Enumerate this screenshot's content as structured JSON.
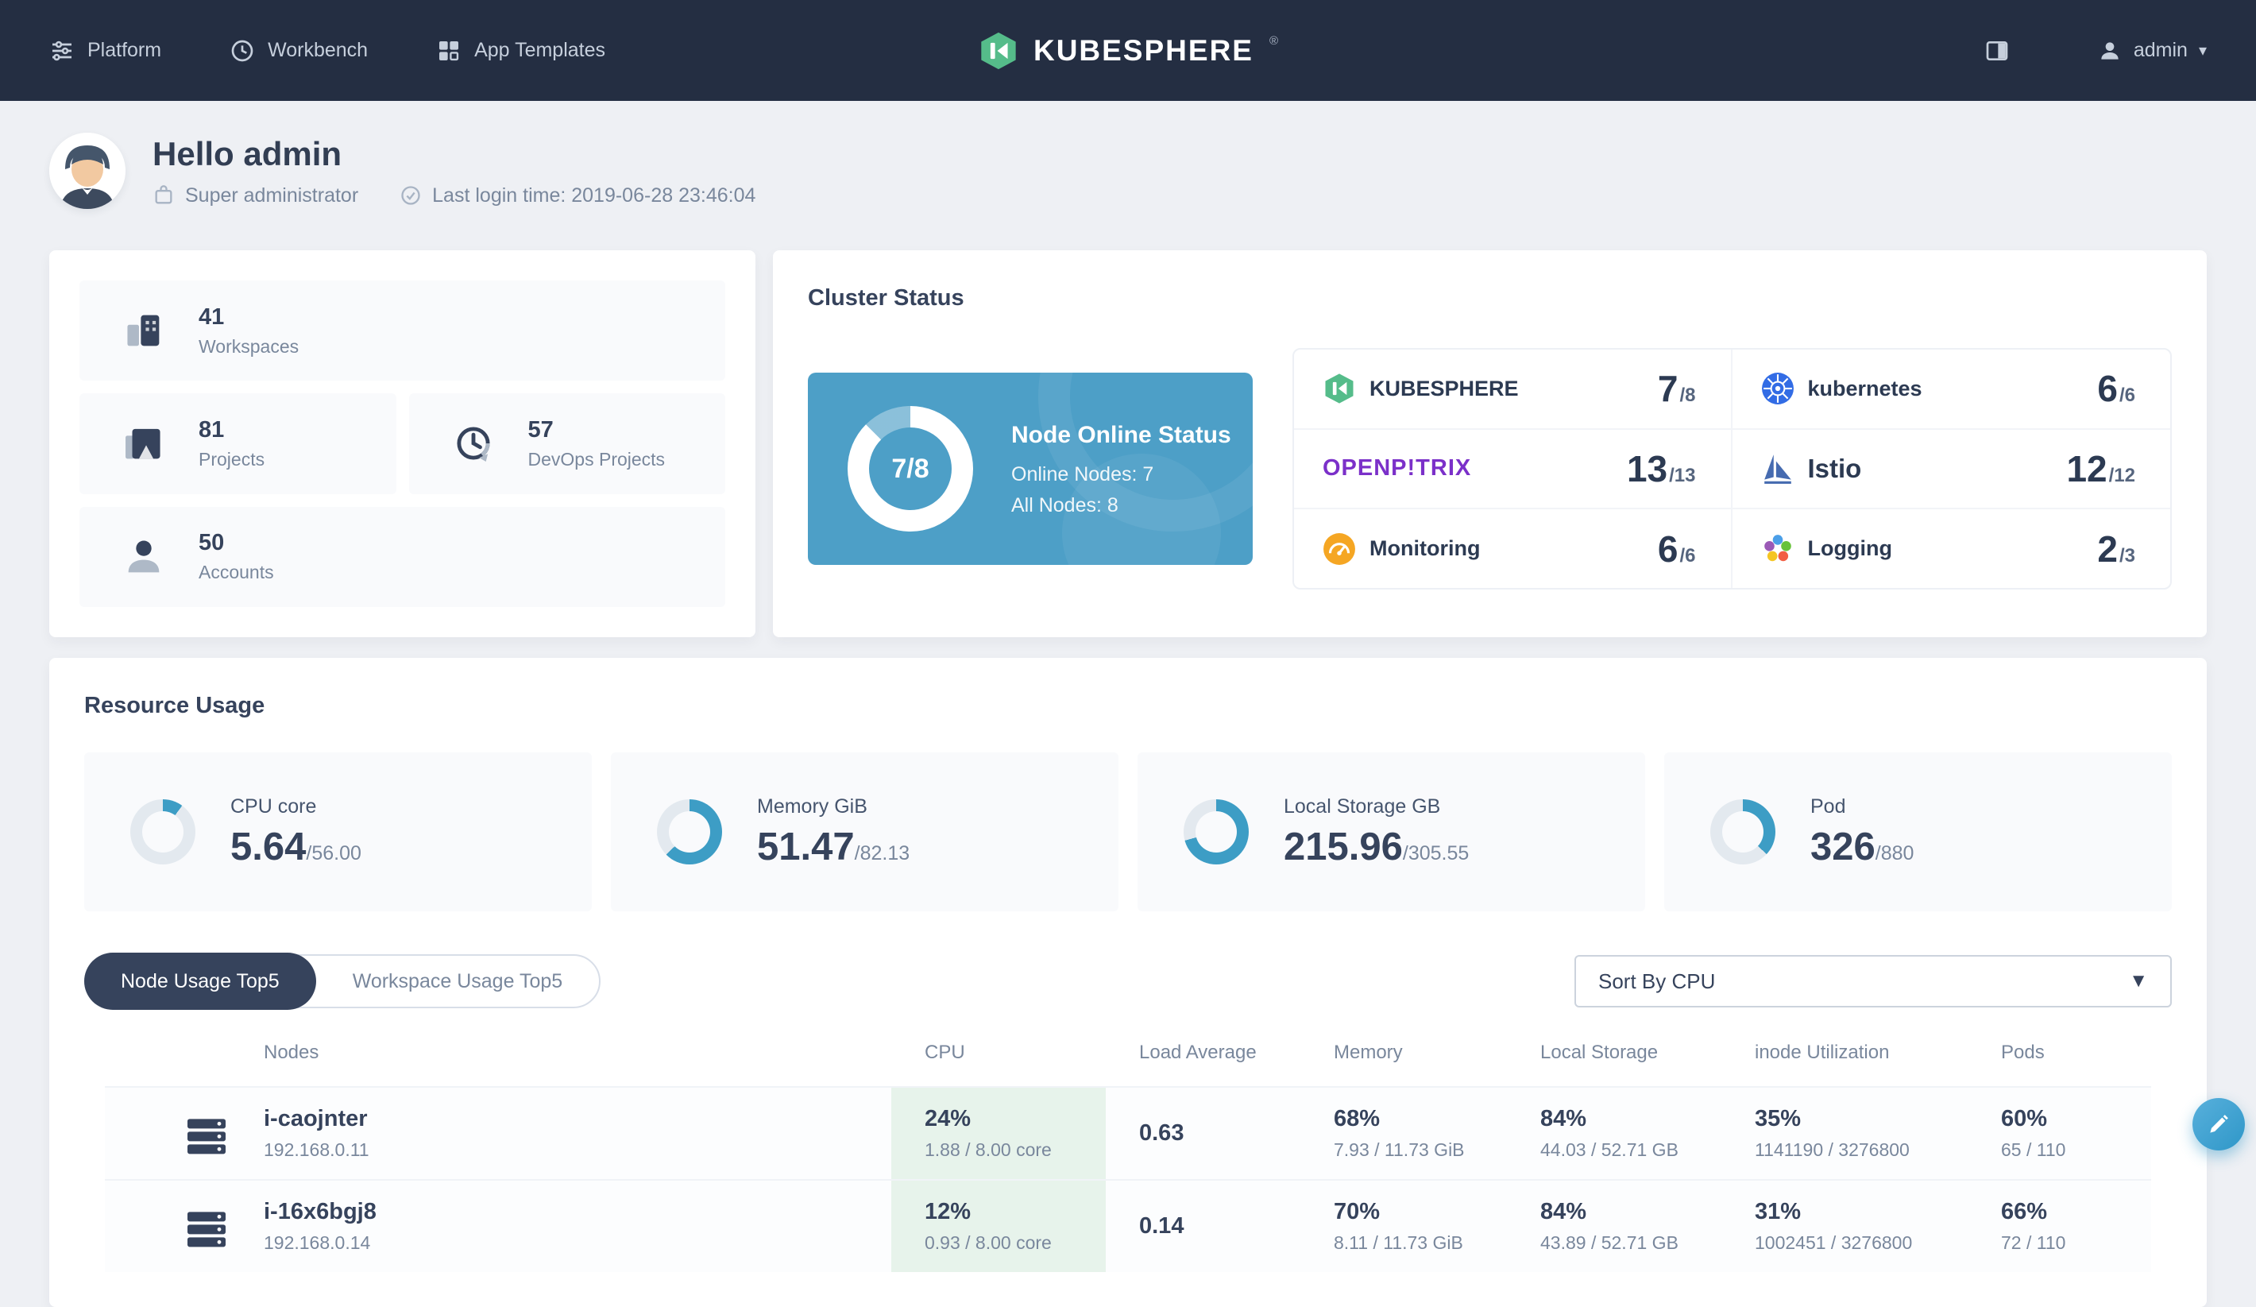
{
  "navbar": {
    "items": [
      {
        "label": "Platform"
      },
      {
        "label": "Workbench"
      },
      {
        "label": "App Templates"
      }
    ],
    "logo_text": "KUBESPHERE",
    "logo_reg": "®",
    "user": "admin",
    "caret": "▾"
  },
  "header": {
    "greeting": "Hello admin",
    "role": "Super administrator",
    "last_login": "Last login time: 2019-06-28 23:46:04"
  },
  "stats": {
    "items": [
      {
        "value": "41",
        "label": "Workspaces"
      },
      {
        "value": "81",
        "label": "Projects"
      },
      {
        "value": "57",
        "label": "DevOps Projects"
      },
      {
        "value": "50",
        "label": "Accounts"
      }
    ]
  },
  "cluster": {
    "title": "Cluster Status",
    "node_status": {
      "fraction": "7/8",
      "percent": 87.5,
      "title": "Node Online Status",
      "online": "Online Nodes: 7",
      "all": "All Nodes: 8"
    },
    "components": [
      {
        "name": "KUBESPHERE",
        "count": "7",
        "total": "/8"
      },
      {
        "name": "kubernetes",
        "count": "6",
        "total": "/6"
      },
      {
        "name": "OPENP!TRIX",
        "count": "13",
        "total": "/13"
      },
      {
        "name": "Istio",
        "count": "12",
        "total": "/12"
      },
      {
        "name": "Monitoring",
        "count": "6",
        "total": "/6"
      },
      {
        "name": "Logging",
        "count": "2",
        "total": "/3"
      }
    ]
  },
  "resources": {
    "title": "Resource Usage",
    "gauges": [
      {
        "label": "CPU core",
        "value": "5.64",
        "total": "/56.00",
        "percent": 10.1
      },
      {
        "label": "Memory GiB",
        "value": "51.47",
        "total": "/82.13",
        "percent": 62.7
      },
      {
        "label": "Local Storage GB",
        "value": "215.96",
        "total": "/305.55",
        "percent": 70.7
      },
      {
        "label": "Pod",
        "value": "326",
        "total": "/880",
        "percent": 37.0
      }
    ],
    "tabs": [
      {
        "label": "Node Usage Top5",
        "active": true
      },
      {
        "label": "Workspace Usage Top5",
        "active": false
      }
    ],
    "sort": {
      "value": "Sort By CPU"
    },
    "table": {
      "headers": [
        "Nodes",
        "CPU",
        "Load Average",
        "Memory",
        "Local Storage",
        "inode Utilization",
        "Pods"
      ],
      "rows": [
        {
          "name": "i-caojnter",
          "ip": "192.168.0.11",
          "cpu_pct": "24%",
          "cpu_detail": "1.88 / 8.00 core",
          "load": "0.63",
          "mem_pct": "68%",
          "mem_detail": "7.93 / 11.73 GiB",
          "storage_pct": "84%",
          "storage_detail": "44.03 / 52.71 GB",
          "inode_pct": "35%",
          "inode_detail": "1141190 / 3276800",
          "pods_pct": "60%",
          "pods_detail": "65 / 110"
        },
        {
          "name": "i-16x6bgj8",
          "ip": "192.168.0.14",
          "cpu_pct": "12%",
          "cpu_detail": "0.93 / 8.00 core",
          "load": "0.14",
          "mem_pct": "70%",
          "mem_detail": "8.11 / 11.73 GiB",
          "storage_pct": "84%",
          "storage_detail": "43.89 / 52.71 GB",
          "inode_pct": "31%",
          "inode_detail": "1002451 / 3276800",
          "pods_pct": "66%",
          "pods_detail": "72 / 110"
        }
      ]
    }
  },
  "colors": {
    "navbar_bg": "#242e42",
    "accent_green": "#55bc8a",
    "panel_blue": "#4d9fc7",
    "donut_white": "#ffffff",
    "donut_track_blue": "rgba(255,255,255,0.35)",
    "gauge_blue": "#3d9dc5",
    "gauge_track": "#e3e9ef",
    "cpu_cell_green": "#e7f3eb",
    "text_dark": "#36435c",
    "text_gray": "#79879c",
    "fab_blue": "#349dcc",
    "kubernetes_blue": "#326ce5",
    "istio_blue": "#466bb0",
    "monitoring_orange": "#f5a623",
    "openpitrix_purple": "#7b30c9"
  }
}
